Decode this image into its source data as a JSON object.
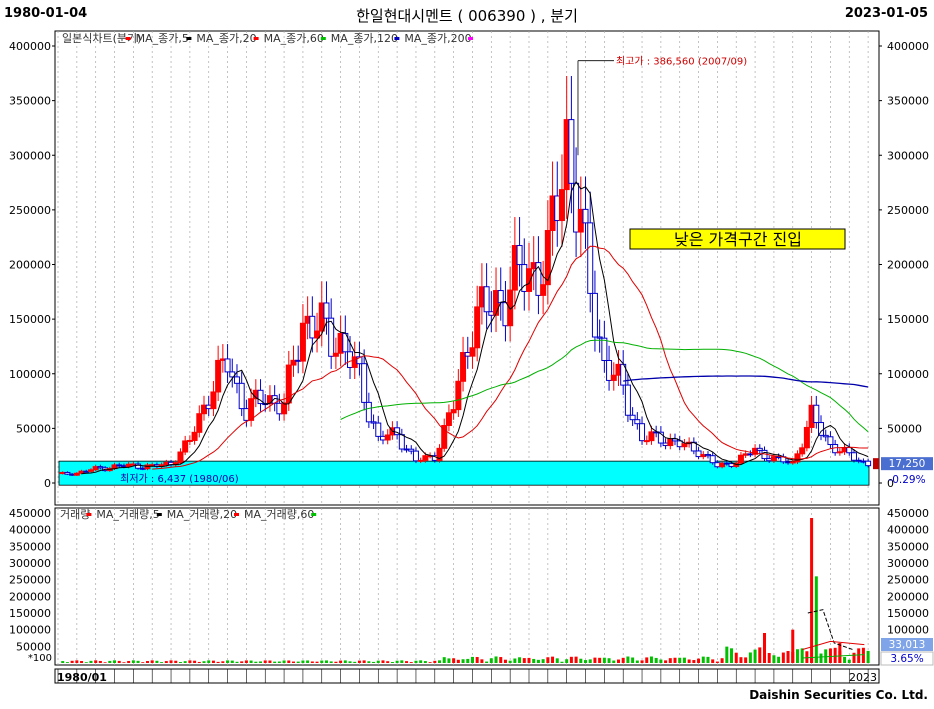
{
  "header": {
    "start_date": "1980-01-04",
    "end_date": "2023-01-05",
    "title": "한일현대시멘트 ( 006390 ) , 분기"
  },
  "footer": {
    "brand": "Daishin Securities Co. Ltd."
  },
  "price_legend": [
    {
      "label": "일본식차트(분기)",
      "marker": "#ff0000"
    },
    {
      "label": "MA_종가,5",
      "marker": "#000000"
    },
    {
      "label": "MA_종가,20",
      "marker": "#ff0000"
    },
    {
      "label": "MA_종가,60",
      "marker": "#00c000"
    },
    {
      "label": "MA_종가,120",
      "marker": "#0000c0"
    },
    {
      "label": "MA_종가,200",
      "marker": "#ff00ff"
    }
  ],
  "volume_legend": [
    {
      "label": "거래량",
      "marker": "#ff0000"
    },
    {
      "label": "MA_거래량,5",
      "marker": "#000000"
    },
    {
      "label": "MA_거래량,20",
      "marker": "#ff0000"
    },
    {
      "label": "MA_거래량,60",
      "marker": "#00c000"
    }
  ],
  "annotations": {
    "high": "최고가 : 386,560 (2007/09)",
    "low": "최저가 : 6,437 (1980/06)",
    "callout": "낮은 가격구간 진입"
  },
  "price_badges": {
    "last": "17,250",
    "change": "-0.29%"
  },
  "volume_badges": {
    "last": "33,013",
    "change": "3.65%",
    "unit": "*100"
  },
  "x_labels": {
    "start": "1980/01",
    "end": "2023"
  },
  "colors": {
    "up": "#ff0000",
    "down": "#0000cc",
    "ma5": "#000000",
    "ma20": "#e00000",
    "ma60": "#00b000",
    "ma120": "#0000aa",
    "zone": "#00ffff",
    "callout_bg": "#ffff00"
  },
  "chart_data": [
    {
      "type": "candlestick",
      "title": "한일현대시멘트 ( 006390 ) , 분기",
      "period": "quarterly",
      "ylim": [
        0,
        400000
      ],
      "y_ticks": [
        "400000",
        "350000",
        "300000",
        "250000",
        "200000",
        "150000",
        "100000",
        "50000",
        "0"
      ],
      "low_price_zone": [
        0,
        20000
      ],
      "key_points": [
        {
          "date": "1980/06",
          "value": 6437,
          "label": "low"
        },
        {
          "date": "2007/09",
          "value": 386560,
          "label": "high"
        },
        {
          "date": "2023/01",
          "value": 17250,
          "label": "last"
        }
      ],
      "series_approx": [
        {
          "year": 1980,
          "close": 8000
        },
        {
          "year": 1981,
          "close": 9000
        },
        {
          "year": 1982,
          "close": 13000
        },
        {
          "year": 1983,
          "close": 15000
        },
        {
          "year": 1984,
          "close": 16000
        },
        {
          "year": 1985,
          "close": 15000
        },
        {
          "year": 1986,
          "close": 18000
        },
        {
          "year": 1987,
          "close": 38000
        },
        {
          "year": 1988,
          "close": 82000
        },
        {
          "year": 1989,
          "close": 110000
        },
        {
          "year": 1990,
          "close": 65000
        },
        {
          "year": 1991,
          "close": 80000
        },
        {
          "year": 1992,
          "close": 70000
        },
        {
          "year": 1993,
          "close": 150000
        },
        {
          "year": 1994,
          "close": 140000
        },
        {
          "year": 1995,
          "close": 130000
        },
        {
          "year": 1996,
          "close": 95000
        },
        {
          "year": 1997,
          "close": 40000
        },
        {
          "year": 1998,
          "close": 45000
        },
        {
          "year": 1999,
          "close": 20000
        },
        {
          "year": 2000,
          "close": 25000
        },
        {
          "year": 2001,
          "close": 70000
        },
        {
          "year": 2002,
          "close": 150000
        },
        {
          "year": 2003,
          "close": 160000
        },
        {
          "year": 2004,
          "close": 180000
        },
        {
          "year": 2005,
          "close": 195000
        },
        {
          "year": 2006,
          "close": 200000
        },
        {
          "year": 2007,
          "close": 320000
        },
        {
          "year": 2008,
          "close": 200000
        },
        {
          "year": 2009,
          "close": 110000
        },
        {
          "year": 2010,
          "close": 85000
        },
        {
          "year": 2011,
          "close": 40000
        },
        {
          "year": 2012,
          "close": 42000
        },
        {
          "year": 2013,
          "close": 35000
        },
        {
          "year": 2014,
          "close": 30000
        },
        {
          "year": 2015,
          "close": 15000
        },
        {
          "year": 2016,
          "close": 20000
        },
        {
          "year": 2017,
          "close": 30000
        },
        {
          "year": 2018,
          "close": 22000
        },
        {
          "year": 2019,
          "close": 18000
        },
        {
          "year": 2020,
          "close": 60000
        },
        {
          "year": 2021,
          "close": 35000
        },
        {
          "year": 2022,
          "close": 25000
        },
        {
          "year": 2023,
          "close": 17250
        }
      ]
    },
    {
      "type": "bar",
      "title": "거래량",
      "unit": "*100",
      "ylim": [
        0,
        450000
      ],
      "y_ticks": [
        "450000",
        "400000",
        "350000",
        "300000",
        "250000",
        "200000",
        "150000",
        "100000",
        "50000"
      ],
      "peak": {
        "year": 2020,
        "value": 435000
      },
      "last": 33013,
      "change": "3.65%"
    }
  ]
}
